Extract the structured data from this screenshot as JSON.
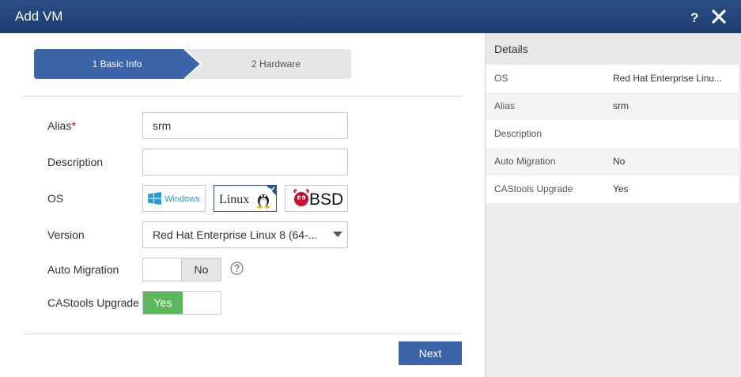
{
  "window": {
    "title": "Add VM",
    "help_label": "?"
  },
  "steps": [
    {
      "label": "1 Basic Info",
      "state": "active"
    },
    {
      "label": "2 Hardware",
      "state": "inactive"
    }
  ],
  "form": {
    "alias": {
      "label": "Alias",
      "required_mark": "*",
      "value": "srm"
    },
    "description": {
      "label": "Description",
      "value": ""
    },
    "os": {
      "label": "OS",
      "options": [
        {
          "name": "Windows",
          "icon": "windows-logo-icon"
        },
        {
          "name": "Linux",
          "icon": "linux-logo-icon",
          "selected": true
        },
        {
          "name": "BSD",
          "icon": "bsd-logo-icon"
        }
      ]
    },
    "version": {
      "label": "Version",
      "value": "Red Hat Enterprise Linux 8 (64-..."
    },
    "auto_migration": {
      "label": "Auto Migration",
      "value": "No",
      "help_icon": "question-circle-icon"
    },
    "castools_upgrade": {
      "label": "CAStools Upgrade",
      "value": "Yes"
    }
  },
  "actions": {
    "next_label": "Next"
  },
  "details": {
    "title": "Details",
    "rows": [
      {
        "key": "OS",
        "value": "Red Hat Enterprise Linu..."
      },
      {
        "key": "Alias",
        "value": "srm"
      },
      {
        "key": "Description",
        "value": ""
      },
      {
        "key": "Auto Migration",
        "value": "No"
      },
      {
        "key": "CAStools Upgrade",
        "value": "Yes"
      }
    ]
  },
  "colors": {
    "titlebar": "#1e3c6e",
    "accent": "#3c64a8",
    "toggle_on": "#5cb85c",
    "required": "#d0021b"
  }
}
